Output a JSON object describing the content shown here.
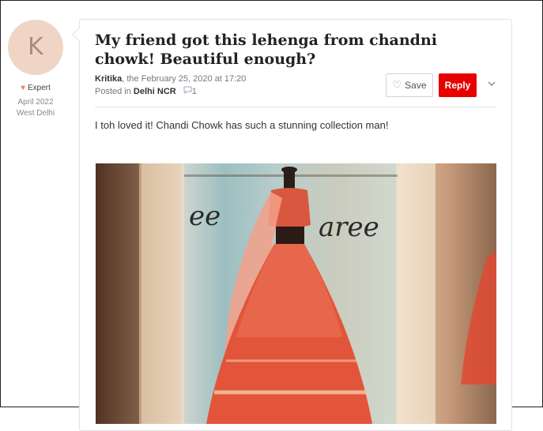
{
  "author_panel": {
    "avatar_letter": "K",
    "badge": "Expert",
    "joined": "April 2022",
    "location": "West Delhi"
  },
  "post": {
    "title": "My friend got this lehenga from chandni chowk! Beautiful enough?",
    "author": "Kritika",
    "date_text": ", the February 25, 2020 at 17:20",
    "posted_in_label": "Posted in ",
    "location": "Delhi NCR",
    "comment_count": "1",
    "body": "I toh loved it! Chandi Chowk has such a stunning collection man!"
  },
  "actions": {
    "save_label": "Save",
    "reply_label": "Reply"
  },
  "photo": {
    "shop_sign_left": "ee",
    "shop_sign_right": "aree"
  },
  "colors": {
    "reply_red": "#e60000",
    "avatar_bg": "#f0d5c7",
    "badge_heart": "#e8826b"
  },
  "icons": [
    "heart-badge-icon",
    "heart-outline-icon",
    "comment-icon",
    "chevron-down-icon"
  ]
}
